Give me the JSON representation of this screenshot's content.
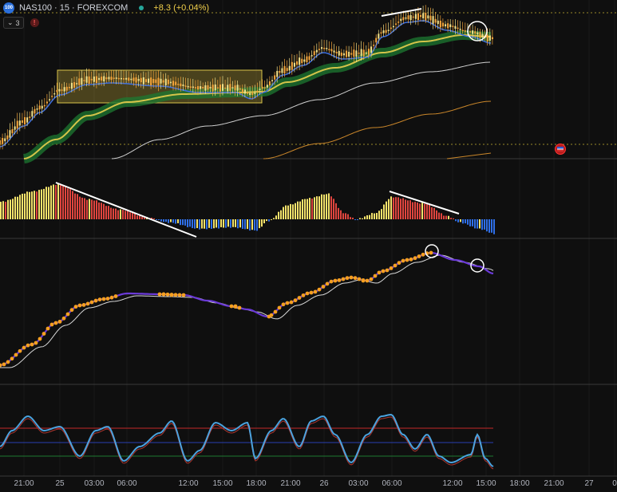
{
  "header": {
    "symbol_badge": "100",
    "title": "NAS100 · 15 · FOREXCOM",
    "change": "+8.3 (+0.04%)"
  },
  "toolbar": {
    "indicators_count": "3",
    "alert_icon": "alert-icon"
  },
  "time_axis": [
    "21:00",
    "25",
    "03:00",
    "06:00",
    "12:00",
    "15:00",
    "18:00",
    "21:00",
    "26",
    "03:00",
    "06:00",
    "12:00",
    "15:00",
    "18:00",
    "21:00",
    "27",
    "0"
  ],
  "colors": {
    "background": "#0f0f0f",
    "candle": "#f2a33a",
    "ema_fast": "#3c6fe0",
    "ema_band": "#1e7a32",
    "ema_line": "#d4c44a",
    "sma_white": "#cfcfcf",
    "sma_orange": "#c9862a",
    "hist_yellow": "#f5e36b",
    "hist_red": "#e0453e",
    "hist_blue": "#2f6fe8",
    "dots": "#f5a020",
    "osc_blue": "#4aa3df",
    "osc_red": "#c62828"
  },
  "chart_data": [
    {
      "type": "line",
      "pane": "price",
      "x_labels": [
        "21:00",
        "25",
        "03:00",
        "06:00",
        "12:00",
        "15:00",
        "18:00",
        "21:00",
        "26",
        "03:00",
        "06:00",
        "12:00",
        "15:00"
      ],
      "y_relative": [
        0.05,
        0.22,
        0.45,
        0.55,
        0.6,
        0.58,
        0.5,
        0.72,
        0.84,
        0.8,
        0.93,
        0.88,
        0.84
      ]
    },
    {
      "type": "bar",
      "pane": "histogram",
      "y_relative": [
        0.6,
        1.0,
        0.5,
        0.0,
        -0.3,
        -0.2,
        0.1,
        0.65,
        0.1,
        0.55,
        0.2,
        -0.4,
        -0.55
      ]
    },
    {
      "type": "line",
      "pane": "trend",
      "y_relative": [
        0.05,
        0.45,
        0.62,
        0.65,
        0.6,
        0.48,
        0.42,
        0.62,
        0.72,
        0.8,
        0.95,
        0.75
      ]
    },
    {
      "type": "line",
      "pane": "oscillator",
      "y_relative": [
        0.35,
        0.9,
        0.2,
        0.8,
        0.1,
        0.85,
        0.15,
        0.75,
        0.1,
        0.9,
        0.15,
        0.85,
        0.1,
        0.9,
        0.2,
        0.7,
        0.05
      ]
    }
  ]
}
